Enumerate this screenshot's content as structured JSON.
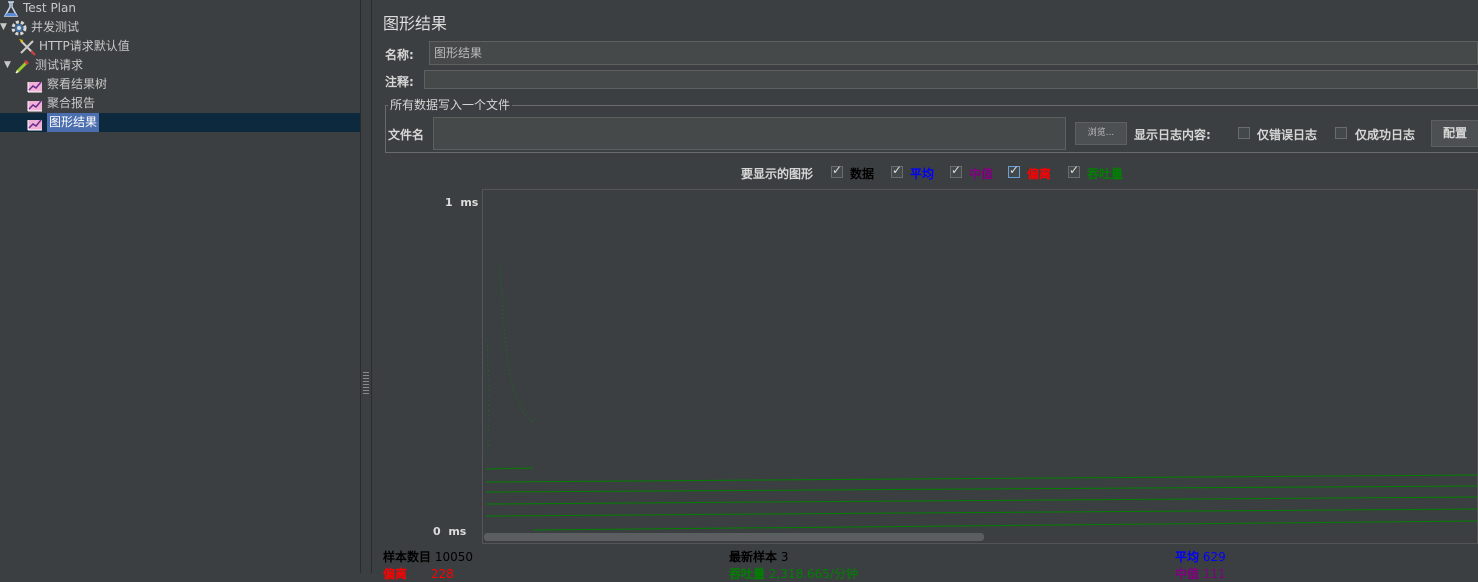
{
  "tree": {
    "items": [
      {
        "label": "Test Plan",
        "icon": "flask-icon"
      },
      {
        "label": "并发测试",
        "icon": "gear-icon",
        "expander": "▼"
      },
      {
        "label": "HTTP请求默认值",
        "icon": "tools-icon"
      },
      {
        "label": "测试请求",
        "icon": "pipette-icon",
        "expander": "▼"
      },
      {
        "label": "察看结果树",
        "icon": "graph-icon"
      },
      {
        "label": "聚合报告",
        "icon": "graph-icon"
      },
      {
        "label": "图形结果",
        "icon": "graph-icon",
        "selected": true
      }
    ]
  },
  "panel": {
    "title": "图形结果",
    "name_label": "名称:",
    "name_value": "图形结果",
    "comment_label": "注释:",
    "comment_value": "",
    "file_group_title": "所有数据写入一个文件",
    "filename_label": "文件名",
    "filename_value": "",
    "browse_button": "浏览...",
    "log_content_label": "显示日志内容:",
    "errors_only_label": "仅错误日志",
    "success_only_label": "仅成功日志",
    "config_button": "配置"
  },
  "graph_options": {
    "label": "要显示的图形",
    "items": [
      {
        "label": "数据",
        "checked": true,
        "color": "#000000"
      },
      {
        "label": "平均",
        "checked": true,
        "color": "#0000ff"
      },
      {
        "label": "中值",
        "checked": true,
        "color": "#800080"
      },
      {
        "label": "偏离",
        "checked": true,
        "color": "#ff0000"
      },
      {
        "label": "吞吐量",
        "checked": true,
        "color": "#008000"
      }
    ]
  },
  "graph": {
    "y_max": "1",
    "y_min": "0",
    "unit": "ms",
    "line_color": "#008000"
  },
  "stats": {
    "samples_label": "样本数目",
    "samples_value": "10050",
    "latest_label": "最新样本",
    "latest_value": "3",
    "avg_label": "平均",
    "avg_value": "629",
    "deviation_label": "偏离",
    "deviation_value": "228",
    "throughput_label": "吞吐量",
    "throughput_value": "2,318.665/分钟",
    "median_label": "中值",
    "median_value": "111"
  }
}
